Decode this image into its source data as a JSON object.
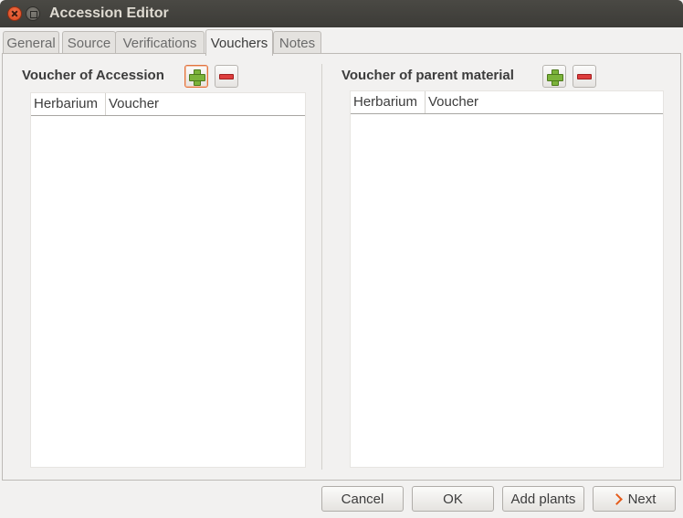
{
  "window": {
    "title": "Accession Editor"
  },
  "tabs": [
    {
      "label": "General"
    },
    {
      "label": "Source"
    },
    {
      "label": "Verifications"
    },
    {
      "label": "Vouchers",
      "active": true
    },
    {
      "label": "Notes"
    }
  ],
  "accession_vouchers": {
    "title": "Voucher of Accession",
    "columns": [
      "Herbarium",
      "Voucher"
    ],
    "rows": []
  },
  "parent_vouchers": {
    "title": "Voucher of parent material",
    "columns": [
      "Herbarium",
      "Voucher"
    ],
    "rows": []
  },
  "icons": {
    "add": "plus-icon",
    "remove": "minus-icon",
    "next": "chevron-right-icon"
  },
  "buttons": {
    "cancel": "Cancel",
    "ok": "OK",
    "add_plants": "Add plants",
    "next": "Next"
  },
  "colors": {
    "titlebar": "#3c3b37",
    "close": "#e95420",
    "add": "#7bb33a",
    "remove": "#dd3d3d",
    "next_arrow": "#e55b1a"
  }
}
